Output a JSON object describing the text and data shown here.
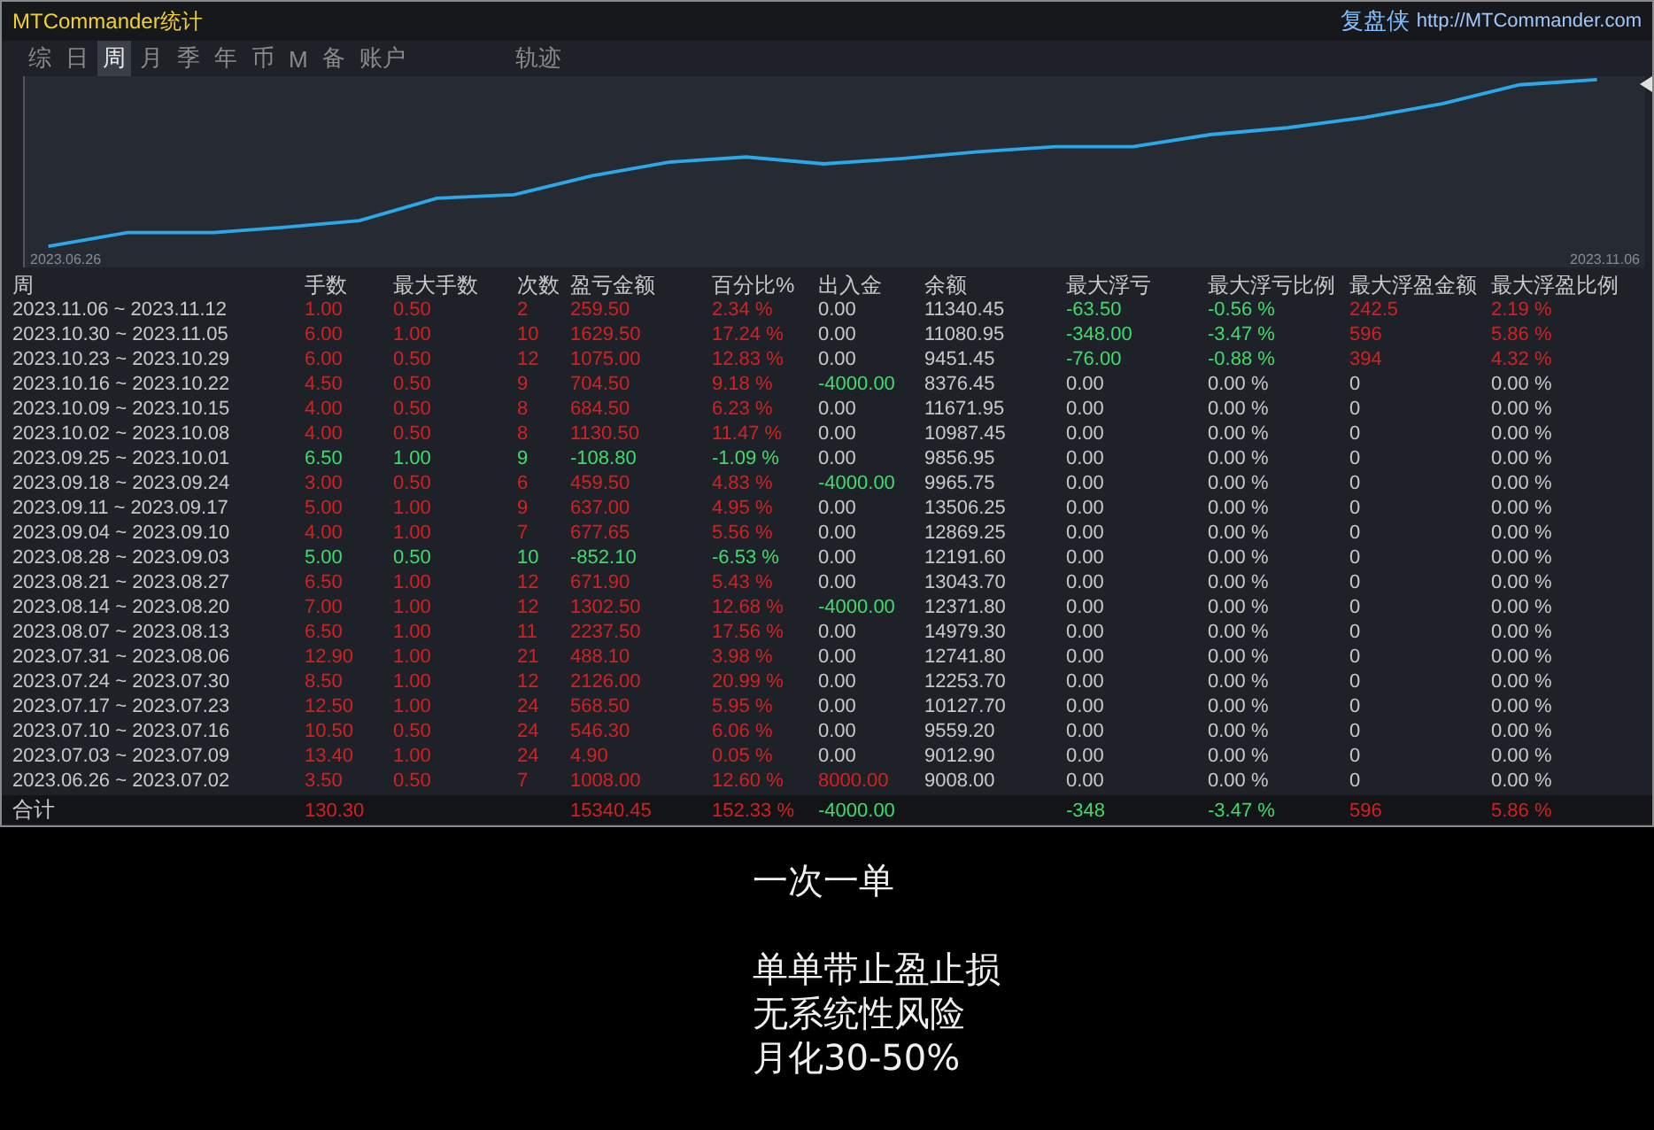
{
  "window": {
    "title": "MTCommander统计",
    "brand": "复盘侠",
    "url": "http://MTCommander.com"
  },
  "tabs": [
    {
      "label": "综",
      "selected": false
    },
    {
      "label": "日",
      "selected": false
    },
    {
      "label": "周",
      "selected": true
    },
    {
      "label": "月",
      "selected": false
    },
    {
      "label": "季",
      "selected": false
    },
    {
      "label": "年",
      "selected": false
    },
    {
      "label": "币",
      "selected": false
    },
    {
      "label": "M",
      "selected": false
    },
    {
      "label": "备",
      "selected": false
    },
    {
      "label": "账户",
      "selected": false
    }
  ],
  "track_tab": {
    "label": "轨迹",
    "selected": false
  },
  "chart": {
    "start_label": "2023.06.26",
    "end_label": "2023.11.06"
  },
  "table": {
    "columns": [
      "周",
      "手数",
      "最大手数",
      "次数",
      "盈亏金额",
      "百分比%",
      "出入金",
      "余额",
      "最大浮亏",
      "最大浮亏比例",
      "最大浮盈金额",
      "最大浮盈比例"
    ],
    "rows": [
      {
        "segments": [
          {
            "color": "#c8c8c8",
            "cells": [
              "2023.11.06 ~ 2023.11.12"
            ]
          },
          {
            "color": "#d42020",
            "cells": [
              "1.00",
              "0.50",
              "2",
              "259.50",
              "2.34 %"
            ]
          },
          {
            "color": "#c8c8c8",
            "cells": [
              "0.00"
            ]
          },
          {
            "color": "#c8c8c8",
            "cells": [
              "11340.45"
            ]
          },
          {
            "color": "#3ddc6a",
            "cells": [
              "-63.50",
              "-0.56 %"
            ]
          },
          {
            "color": "#d42020",
            "cells": [
              "242.5",
              "2.19 %"
            ]
          }
        ]
      },
      {
        "segments": [
          {
            "color": "#c8c8c8",
            "cells": [
              "2023.10.30 ~ 2023.11.05"
            ]
          },
          {
            "color": "#d42020",
            "cells": [
              "6.00",
              "1.00",
              "10",
              "1629.50",
              "17.24 %"
            ]
          },
          {
            "color": "#c8c8c8",
            "cells": [
              "0.00"
            ]
          },
          {
            "color": "#c8c8c8",
            "cells": [
              "11080.95"
            ]
          },
          {
            "color": "#3ddc6a",
            "cells": [
              "-348.00",
              "-3.47 %"
            ]
          },
          {
            "color": "#d42020",
            "cells": [
              "596",
              "5.86 %"
            ]
          }
        ]
      },
      {
        "segments": [
          {
            "color": "#c8c8c8",
            "cells": [
              "2023.10.23 ~ 2023.10.29"
            ]
          },
          {
            "color": "#d42020",
            "cells": [
              "6.00",
              "0.50",
              "12",
              "1075.00",
              "12.83 %"
            ]
          },
          {
            "color": "#c8c8c8",
            "cells": [
              "0.00"
            ]
          },
          {
            "color": "#c8c8c8",
            "cells": [
              "9451.45"
            ]
          },
          {
            "color": "#3ddc6a",
            "cells": [
              "-76.00",
              "-0.88 %"
            ]
          },
          {
            "color": "#d42020",
            "cells": [
              "394",
              "4.32 %"
            ]
          }
        ]
      },
      {
        "segments": [
          {
            "color": "#c8c8c8",
            "cells": [
              "2023.10.16 ~ 2023.10.22"
            ]
          },
          {
            "color": "#d42020",
            "cells": [
              "4.50",
              "0.50",
              "9",
              "704.50",
              "9.18 %"
            ]
          },
          {
            "color": "#3ddc6a",
            "cells": [
              "-4000.00"
            ]
          },
          {
            "color": "#c8c8c8",
            "cells": [
              "8376.45"
            ]
          },
          {
            "color": "#c8c8c8",
            "cells": [
              "0.00",
              "0.00 %"
            ]
          },
          {
            "color": "#c8c8c8",
            "cells": [
              "0",
              "0.00 %"
            ]
          }
        ]
      },
      {
        "segments": [
          {
            "color": "#c8c8c8",
            "cells": [
              "2023.10.09 ~ 2023.10.15"
            ]
          },
          {
            "color": "#d42020",
            "cells": [
              "4.00",
              "0.50",
              "8",
              "684.50",
              "6.23 %"
            ]
          },
          {
            "color": "#c8c8c8",
            "cells": [
              "0.00"
            ]
          },
          {
            "color": "#c8c8c8",
            "cells": [
              "11671.95"
            ]
          },
          {
            "color": "#c8c8c8",
            "cells": [
              "0.00",
              "0.00 %"
            ]
          },
          {
            "color": "#c8c8c8",
            "cells": [
              "0",
              "0.00 %"
            ]
          }
        ]
      },
      {
        "segments": [
          {
            "color": "#c8c8c8",
            "cells": [
              "2023.10.02 ~ 2023.10.08"
            ]
          },
          {
            "color": "#d42020",
            "cells": [
              "4.00",
              "0.50",
              "8",
              "1130.50",
              "11.47 %"
            ]
          },
          {
            "color": "#c8c8c8",
            "cells": [
              "0.00"
            ]
          },
          {
            "color": "#c8c8c8",
            "cells": [
              "10987.45"
            ]
          },
          {
            "color": "#c8c8c8",
            "cells": [
              "0.00",
              "0.00 %"
            ]
          },
          {
            "color": "#c8c8c8",
            "cells": [
              "0",
              "0.00 %"
            ]
          }
        ]
      },
      {
        "segments": [
          {
            "color": "#c8c8c8",
            "cells": [
              "2023.09.25 ~ 2023.10.01"
            ]
          },
          {
            "color": "#3ddc6a",
            "cells": [
              "6.50",
              "1.00",
              "9",
              "-108.80",
              "-1.09 %"
            ]
          },
          {
            "color": "#c8c8c8",
            "cells": [
              "0.00"
            ]
          },
          {
            "color": "#c8c8c8",
            "cells": [
              "9856.95"
            ]
          },
          {
            "color": "#c8c8c8",
            "cells": [
              "0.00",
              "0.00 %"
            ]
          },
          {
            "color": "#c8c8c8",
            "cells": [
              "0",
              "0.00 %"
            ]
          }
        ]
      },
      {
        "segments": [
          {
            "color": "#c8c8c8",
            "cells": [
              "2023.09.18 ~ 2023.09.24"
            ]
          },
          {
            "color": "#d42020",
            "cells": [
              "3.00",
              "0.50",
              "6",
              "459.50",
              "4.83 %"
            ]
          },
          {
            "color": "#3ddc6a",
            "cells": [
              "-4000.00"
            ]
          },
          {
            "color": "#c8c8c8",
            "cells": [
              "9965.75"
            ]
          },
          {
            "color": "#c8c8c8",
            "cells": [
              "0.00",
              "0.00 %"
            ]
          },
          {
            "color": "#c8c8c8",
            "cells": [
              "0",
              "0.00 %"
            ]
          }
        ]
      },
      {
        "segments": [
          {
            "color": "#c8c8c8",
            "cells": [
              "2023.09.11 ~ 2023.09.17"
            ]
          },
          {
            "color": "#d42020",
            "cells": [
              "5.00",
              "1.00",
              "9",
              "637.00",
              "4.95 %"
            ]
          },
          {
            "color": "#c8c8c8",
            "cells": [
              "0.00"
            ]
          },
          {
            "color": "#c8c8c8",
            "cells": [
              "13506.25"
            ]
          },
          {
            "color": "#c8c8c8",
            "cells": [
              "0.00",
              "0.00 %"
            ]
          },
          {
            "color": "#c8c8c8",
            "cells": [
              "0",
              "0.00 %"
            ]
          }
        ]
      },
      {
        "segments": [
          {
            "color": "#c8c8c8",
            "cells": [
              "2023.09.04 ~ 2023.09.10"
            ]
          },
          {
            "color": "#d42020",
            "cells": [
              "4.00",
              "1.00",
              "7",
              "677.65",
              "5.56 %"
            ]
          },
          {
            "color": "#c8c8c8",
            "cells": [
              "0.00"
            ]
          },
          {
            "color": "#c8c8c8",
            "cells": [
              "12869.25"
            ]
          },
          {
            "color": "#c8c8c8",
            "cells": [
              "0.00",
              "0.00 %"
            ]
          },
          {
            "color": "#c8c8c8",
            "cells": [
              "0",
              "0.00 %"
            ]
          }
        ]
      },
      {
        "segments": [
          {
            "color": "#c8c8c8",
            "cells": [
              "2023.08.28 ~ 2023.09.03"
            ]
          },
          {
            "color": "#3ddc6a",
            "cells": [
              "5.00",
              "0.50",
              "10",
              "-852.10",
              "-6.53 %"
            ]
          },
          {
            "color": "#c8c8c8",
            "cells": [
              "0.00"
            ]
          },
          {
            "color": "#c8c8c8",
            "cells": [
              "12191.60"
            ]
          },
          {
            "color": "#c8c8c8",
            "cells": [
              "0.00",
              "0.00 %"
            ]
          },
          {
            "color": "#c8c8c8",
            "cells": [
              "0",
              "0.00 %"
            ]
          }
        ]
      },
      {
        "segments": [
          {
            "color": "#c8c8c8",
            "cells": [
              "2023.08.21 ~ 2023.08.27"
            ]
          },
          {
            "color": "#d42020",
            "cells": [
              "6.50",
              "1.00",
              "12",
              "671.90",
              "5.43 %"
            ]
          },
          {
            "color": "#c8c8c8",
            "cells": [
              "0.00"
            ]
          },
          {
            "color": "#c8c8c8",
            "cells": [
              "13043.70"
            ]
          },
          {
            "color": "#c8c8c8",
            "cells": [
              "0.00",
              "0.00 %"
            ]
          },
          {
            "color": "#c8c8c8",
            "cells": [
              "0",
              "0.00 %"
            ]
          }
        ]
      },
      {
        "segments": [
          {
            "color": "#c8c8c8",
            "cells": [
              "2023.08.14 ~ 2023.08.20"
            ]
          },
          {
            "color": "#d42020",
            "cells": [
              "7.00",
              "1.00",
              "12",
              "1302.50",
              "12.68 %"
            ]
          },
          {
            "color": "#3ddc6a",
            "cells": [
              "-4000.00"
            ]
          },
          {
            "color": "#c8c8c8",
            "cells": [
              "12371.80"
            ]
          },
          {
            "color": "#c8c8c8",
            "cells": [
              "0.00",
              "0.00 %"
            ]
          },
          {
            "color": "#c8c8c8",
            "cells": [
              "0",
              "0.00 %"
            ]
          }
        ]
      },
      {
        "segments": [
          {
            "color": "#c8c8c8",
            "cells": [
              "2023.08.07 ~ 2023.08.13"
            ]
          },
          {
            "color": "#d42020",
            "cells": [
              "6.50",
              "1.00",
              "11",
              "2237.50",
              "17.56 %"
            ]
          },
          {
            "color": "#c8c8c8",
            "cells": [
              "0.00"
            ]
          },
          {
            "color": "#c8c8c8",
            "cells": [
              "14979.30"
            ]
          },
          {
            "color": "#c8c8c8",
            "cells": [
              "0.00",
              "0.00 %"
            ]
          },
          {
            "color": "#c8c8c8",
            "cells": [
              "0",
              "0.00 %"
            ]
          }
        ]
      },
      {
        "segments": [
          {
            "color": "#c8c8c8",
            "cells": [
              "2023.07.31 ~ 2023.08.06"
            ]
          },
          {
            "color": "#d42020",
            "cells": [
              "12.90",
              "1.00",
              "21",
              "488.10",
              "3.98 %"
            ]
          },
          {
            "color": "#c8c8c8",
            "cells": [
              "0.00"
            ]
          },
          {
            "color": "#c8c8c8",
            "cells": [
              "12741.80"
            ]
          },
          {
            "color": "#c8c8c8",
            "cells": [
              "0.00",
              "0.00 %"
            ]
          },
          {
            "color": "#c8c8c8",
            "cells": [
              "0",
              "0.00 %"
            ]
          }
        ]
      },
      {
        "segments": [
          {
            "color": "#c8c8c8",
            "cells": [
              "2023.07.24 ~ 2023.07.30"
            ]
          },
          {
            "color": "#d42020",
            "cells": [
              "8.50",
              "1.00",
              "12",
              "2126.00",
              "20.99 %"
            ]
          },
          {
            "color": "#c8c8c8",
            "cells": [
              "0.00"
            ]
          },
          {
            "color": "#c8c8c8",
            "cells": [
              "12253.70"
            ]
          },
          {
            "color": "#c8c8c8",
            "cells": [
              "0.00",
              "0.00 %"
            ]
          },
          {
            "color": "#c8c8c8",
            "cells": [
              "0",
              "0.00 %"
            ]
          }
        ]
      },
      {
        "segments": [
          {
            "color": "#c8c8c8",
            "cells": [
              "2023.07.17 ~ 2023.07.23"
            ]
          },
          {
            "color": "#d42020",
            "cells": [
              "12.50",
              "1.00",
              "24",
              "568.50",
              "5.95 %"
            ]
          },
          {
            "color": "#c8c8c8",
            "cells": [
              "0.00"
            ]
          },
          {
            "color": "#c8c8c8",
            "cells": [
              "10127.70"
            ]
          },
          {
            "color": "#c8c8c8",
            "cells": [
              "0.00",
              "0.00 %"
            ]
          },
          {
            "color": "#c8c8c8",
            "cells": [
              "0",
              "0.00 %"
            ]
          }
        ]
      },
      {
        "segments": [
          {
            "color": "#c8c8c8",
            "cells": [
              "2023.07.10 ~ 2023.07.16"
            ]
          },
          {
            "color": "#d42020",
            "cells": [
              "10.50",
              "0.50",
              "24",
              "546.30",
              "6.06 %"
            ]
          },
          {
            "color": "#c8c8c8",
            "cells": [
              "0.00"
            ]
          },
          {
            "color": "#c8c8c8",
            "cells": [
              "9559.20"
            ]
          },
          {
            "color": "#c8c8c8",
            "cells": [
              "0.00",
              "0.00 %"
            ]
          },
          {
            "color": "#c8c8c8",
            "cells": [
              "0",
              "0.00 %"
            ]
          }
        ]
      },
      {
        "segments": [
          {
            "color": "#c8c8c8",
            "cells": [
              "2023.07.03 ~ 2023.07.09"
            ]
          },
          {
            "color": "#d42020",
            "cells": [
              "13.40",
              "1.00",
              "24",
              "4.90",
              "0.05 %"
            ]
          },
          {
            "color": "#c8c8c8",
            "cells": [
              "0.00"
            ]
          },
          {
            "color": "#c8c8c8",
            "cells": [
              "9012.90"
            ]
          },
          {
            "color": "#c8c8c8",
            "cells": [
              "0.00",
              "0.00 %"
            ]
          },
          {
            "color": "#c8c8c8",
            "cells": [
              "0",
              "0.00 %"
            ]
          }
        ]
      },
      {
        "segments": [
          {
            "color": "#c8c8c8",
            "cells": [
              "2023.06.26 ~ 2023.07.02"
            ]
          },
          {
            "color": "#d42020",
            "cells": [
              "3.50",
              "0.50",
              "7",
              "1008.00",
              "12.60 %"
            ]
          },
          {
            "color": "#d42020",
            "cells": [
              "8000.00"
            ]
          },
          {
            "color": "#c8c8c8",
            "cells": [
              "9008.00"
            ]
          },
          {
            "color": "#c8c8c8",
            "cells": [
              "0.00",
              "0.00 %"
            ]
          },
          {
            "color": "#c8c8c8",
            "cells": [
              "0",
              "0.00 %"
            ]
          }
        ]
      }
    ],
    "total": {
      "segments": [
        {
          "color": "#c8c8c8",
          "cells": [
            "合计"
          ]
        },
        {
          "color": "#d42020",
          "cells": [
            "130.30",
            null,
            null,
            "15340.45",
            "152.33 %"
          ]
        },
        {
          "color": "#3ddc6a",
          "cells": [
            "-4000.00"
          ]
        },
        {
          "cells": [
            null
          ]
        },
        {
          "color": "#3ddc6a",
          "cells": [
            "-348",
            "-3.47 %"
          ]
        },
        {
          "color": "#d42020",
          "cells": [
            "596",
            "5.86 %"
          ]
        }
      ]
    }
  },
  "caption": {
    "heading": "一次一单",
    "lines": [
      "单单带止盈止损",
      "无系统性风险",
      "月化30-50%"
    ]
  }
}
